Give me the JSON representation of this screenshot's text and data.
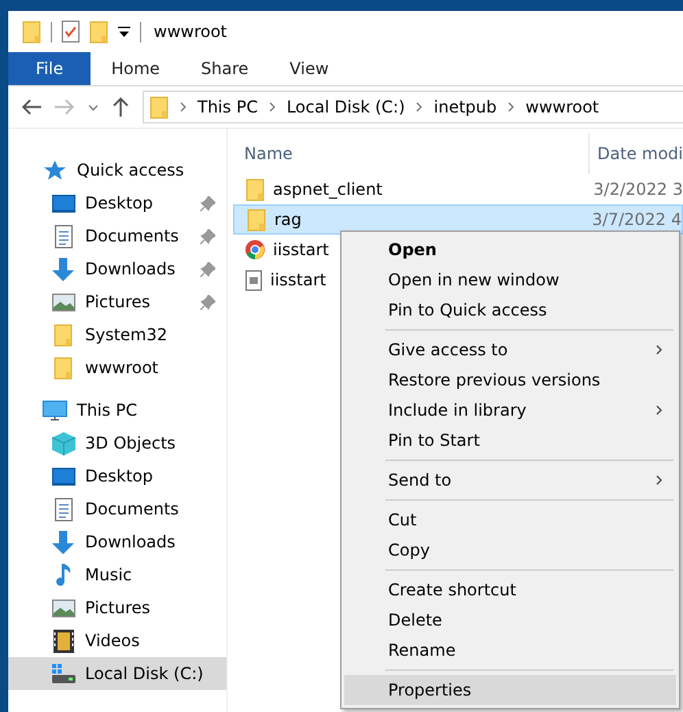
{
  "window": {
    "title": "wwwroot"
  },
  "ribbon_tabs": [
    {
      "label": "File",
      "selected": true
    },
    {
      "label": "Home",
      "selected": false
    },
    {
      "label": "Share",
      "selected": false
    },
    {
      "label": "View",
      "selected": false
    }
  ],
  "address_bar": {
    "path": [
      "This PC",
      "Local Disk (C:)",
      "inetpub",
      "wwwroot"
    ]
  },
  "sidebar": {
    "items": [
      {
        "label": "Quick access",
        "kind": "quick",
        "selected": false,
        "children": [
          {
            "label": "Desktop",
            "kind": "desktop",
            "pinned": true,
            "selected": false
          },
          {
            "label": "Documents",
            "kind": "documents",
            "pinned": true,
            "selected": false
          },
          {
            "label": "Downloads",
            "kind": "downloads",
            "pinned": true,
            "selected": false
          },
          {
            "label": "Pictures",
            "kind": "pictures",
            "pinned": true,
            "selected": false
          },
          {
            "label": "System32",
            "kind": "folder",
            "pinned": false,
            "selected": false
          },
          {
            "label": "wwwroot",
            "kind": "folder",
            "pinned": false,
            "selected": false
          }
        ]
      },
      {
        "label": "This PC",
        "kind": "pc",
        "selected": false,
        "children": [
          {
            "label": "3D Objects",
            "kind": "objects3d",
            "pinned": false,
            "selected": false
          },
          {
            "label": "Desktop",
            "kind": "desktop",
            "pinned": false,
            "selected": false
          },
          {
            "label": "Documents",
            "kind": "documents",
            "pinned": false,
            "selected": false
          },
          {
            "label": "Downloads",
            "kind": "downloads",
            "pinned": false,
            "selected": false
          },
          {
            "label": "Music",
            "kind": "music",
            "pinned": false,
            "selected": false
          },
          {
            "label": "Pictures",
            "kind": "pictures",
            "pinned": false,
            "selected": false
          },
          {
            "label": "Videos",
            "kind": "videos",
            "pinned": false,
            "selected": false
          },
          {
            "label": "Local Disk (C:)",
            "kind": "disk",
            "pinned": false,
            "selected": true
          }
        ]
      }
    ]
  },
  "file_list": {
    "columns": [
      "Name",
      "Date modi"
    ],
    "rows": [
      {
        "name": "aspnet_client",
        "kind": "folder",
        "date": "3/2/2022 3",
        "selected": false
      },
      {
        "name": "rag",
        "kind": "folder",
        "date": "3/7/2022 4",
        "selected": true
      },
      {
        "name": "iisstart",
        "kind": "browser",
        "selected": false
      },
      {
        "name": "iisstart",
        "kind": "image",
        "selected": false
      }
    ]
  },
  "context_menu": {
    "items": [
      {
        "kind": "item",
        "label": "Open",
        "bold": true,
        "submenu": false,
        "selected": false
      },
      {
        "kind": "item",
        "label": "Open in new window",
        "bold": false,
        "submenu": false,
        "selected": false
      },
      {
        "kind": "item",
        "label": "Pin to Quick access",
        "bold": false,
        "submenu": false,
        "selected": false
      },
      {
        "kind": "separator"
      },
      {
        "kind": "item",
        "label": "Give access to",
        "bold": false,
        "submenu": true,
        "selected": false
      },
      {
        "kind": "item",
        "label": "Restore previous versions",
        "bold": false,
        "submenu": false,
        "selected": false
      },
      {
        "kind": "item",
        "label": "Include in library",
        "bold": false,
        "submenu": true,
        "selected": false
      },
      {
        "kind": "item",
        "label": "Pin to Start",
        "bold": false,
        "submenu": false,
        "selected": false
      },
      {
        "kind": "separator"
      },
      {
        "kind": "item",
        "label": "Send to",
        "bold": false,
        "submenu": true,
        "selected": false
      },
      {
        "kind": "separator"
      },
      {
        "kind": "item",
        "label": "Cut",
        "bold": false,
        "submenu": false,
        "selected": false
      },
      {
        "kind": "item",
        "label": "Copy",
        "bold": false,
        "submenu": false,
        "selected": false
      },
      {
        "kind": "separator"
      },
      {
        "kind": "item",
        "label": "Create shortcut",
        "bold": false,
        "submenu": false,
        "selected": false
      },
      {
        "kind": "item",
        "label": "Delete",
        "bold": false,
        "submenu": false,
        "selected": false
      },
      {
        "kind": "item",
        "label": "Rename",
        "bold": false,
        "submenu": false,
        "selected": false
      },
      {
        "kind": "separator"
      },
      {
        "kind": "item",
        "label": "Properties",
        "bold": false,
        "submenu": false,
        "selected": true
      }
    ]
  }
}
